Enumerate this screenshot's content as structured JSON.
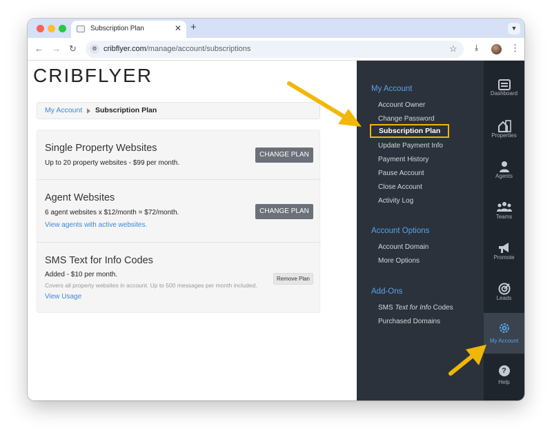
{
  "browser": {
    "tab_title": "Subscription Plan",
    "url_domain": "cribflyer.com",
    "url_path": "/manage/account/subscriptions"
  },
  "logo": "CRIBFLYER",
  "breadcrumb": {
    "parent": "My Account",
    "current": "Subscription Plan"
  },
  "plans": [
    {
      "title": "Single Property Websites",
      "desc": "Up to 20 property websites - $99 per month.",
      "button": "CHANGE PLAN"
    },
    {
      "title": "Agent Websites",
      "desc": "6 agent websites x $12/month = $72/month.",
      "link": "View agents with active websites.",
      "button": "CHANGE PLAN"
    },
    {
      "title": "SMS Text for Info Codes",
      "desc": "Added - $10 per month.",
      "note": "Covers all property websites in account. Up to 500 messages per month included.",
      "link": "View Usage",
      "button": "Remove Plan"
    }
  ],
  "account_menu": {
    "my_account": {
      "title": "My Account",
      "items": [
        "Account Owner",
        "Change Password",
        "Subscription Plan",
        "Update Payment Info",
        "Payment History",
        "Pause Account",
        "Close Account",
        "Activity Log"
      ],
      "active": "Subscription Plan"
    },
    "account_options": {
      "title": "Account Options",
      "items": [
        "Account Domain",
        "More Options"
      ]
    },
    "add_ons": {
      "title": "Add-Ons",
      "sms_prefix": "SMS ",
      "sms_italic": "Text for Info",
      "sms_suffix": " Codes",
      "purchased": "Purchased Domains"
    }
  },
  "rail": {
    "items": [
      {
        "label": "Dashboard",
        "icon": "dashboard-icon"
      },
      {
        "label": "Properties",
        "icon": "properties-icon"
      },
      {
        "label": "Agents",
        "icon": "agent-icon"
      },
      {
        "label": "Teams",
        "icon": "teams-icon"
      },
      {
        "label": "Promote",
        "icon": "megaphone-icon"
      },
      {
        "label": "Leads",
        "icon": "target-icon"
      },
      {
        "label": "My Account",
        "icon": "gear-icon"
      },
      {
        "label": "Help",
        "icon": "help-icon"
      }
    ],
    "active": "My Account"
  },
  "colors": {
    "accent": "#5aa3e8",
    "highlight": "#f2b705",
    "sidebar": "#2b323b",
    "rail": "#1f252c"
  }
}
